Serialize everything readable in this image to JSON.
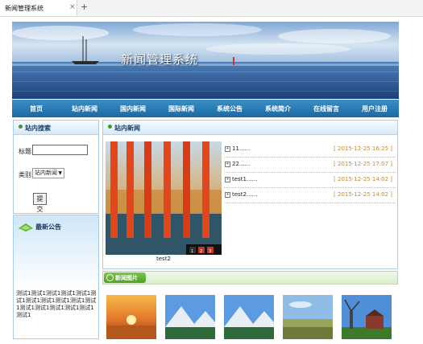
{
  "browser": {
    "tab_title": "新闻管理系统",
    "close_glyph": "×",
    "new_tab_glyph": "+"
  },
  "banner": {
    "title": "新闻管理系统"
  },
  "nav": {
    "items": [
      "首页",
      "站内新闻",
      "国内新闻",
      "国际新闻",
      "系统公告",
      "系统简介",
      "在线留言",
      "用户注册"
    ]
  },
  "search": {
    "title": "站内搜索",
    "title_label": "标题",
    "title_value": "",
    "category_label": "类别",
    "category_selected": "站内新闻",
    "submit_label": "提交"
  },
  "notice": {
    "title": "最新公告",
    "text": "测试1测试1测试1测试1测试1测试1测试1测试1测试1测试1测试1测试1测试1测试1测试1测试1测试1"
  },
  "news": {
    "title": "站内新闻",
    "slide_caption": "test2",
    "slide_pager": [
      "1",
      "2",
      "3"
    ],
    "items": [
      {
        "title": "11......",
        "date": "[ 2015-12-25 16:25 ]"
      },
      {
        "title": "22......",
        "date": "[ 2015-12-25 17:07 ]"
      },
      {
        "title": "test1......",
        "date": "[ 2015-12-25 14:02 ]"
      },
      {
        "title": "test2......",
        "date": "[ 2015-12-25 14:02 ]"
      }
    ]
  },
  "pictures": {
    "title": "新闻图片"
  },
  "colors": {
    "nav_blue": "#1f72ad",
    "panel_border": "#a9cde8",
    "date_color": "#c08a3a",
    "green_tab": "#5aab2a"
  }
}
